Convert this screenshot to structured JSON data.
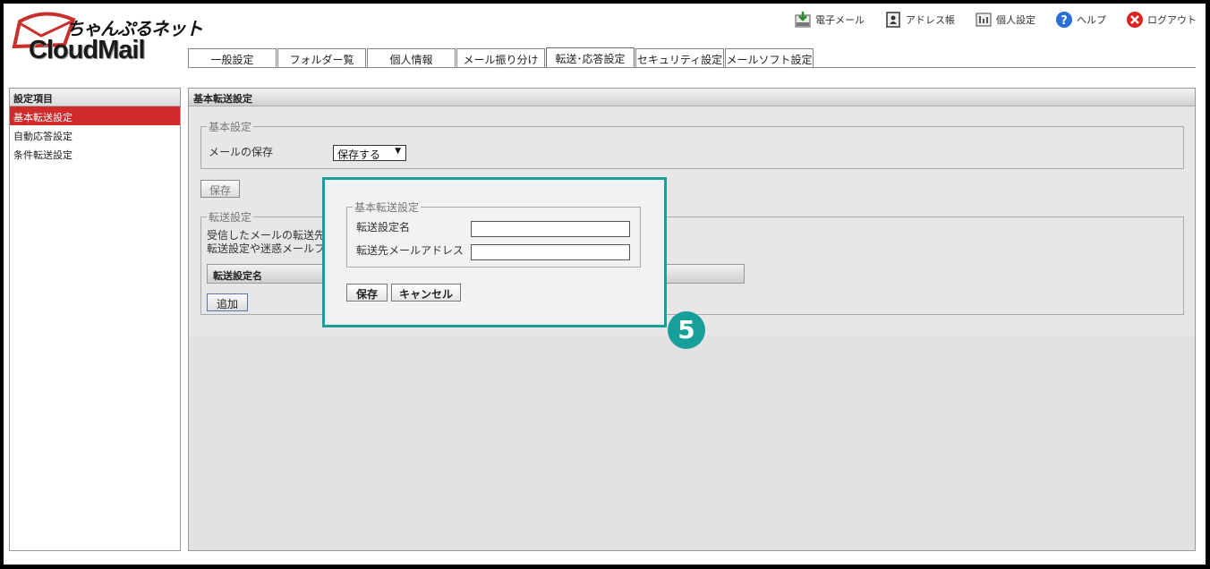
{
  "brand": {
    "logo_jp": "ちゃんぷるネット",
    "logo_en": "CloudMail"
  },
  "topnav": [
    {
      "label": "電子メール",
      "icon": "mail-download-icon"
    },
    {
      "label": "アドレス帳",
      "icon": "address-book-icon"
    },
    {
      "label": "個人設定",
      "icon": "personal-settings-icon"
    },
    {
      "label": "ヘルプ",
      "icon": "help-icon"
    },
    {
      "label": "ログアウト",
      "icon": "logout-icon"
    }
  ],
  "tabs": [
    {
      "label": "一般設定",
      "active": false
    },
    {
      "label": "フォルダー覧",
      "active": false
    },
    {
      "label": "個人情報",
      "active": false
    },
    {
      "label": "メール振り分け",
      "active": false
    },
    {
      "label": "転送･応答設定",
      "active": true
    },
    {
      "label": "セキュリティ設定",
      "active": false
    },
    {
      "label": "メールソフト設定",
      "active": false
    }
  ],
  "sidebar": {
    "header": "設定項目",
    "items": [
      {
        "label": "基本転送設定",
        "active": true
      },
      {
        "label": "自動応答設定",
        "active": false
      },
      {
        "label": "条件転送設定",
        "active": false
      }
    ]
  },
  "main": {
    "header": "基本転送設定",
    "basic": {
      "legend": "基本設定",
      "save_mail_label": "メールの保存",
      "save_mail_value": "保存する",
      "save_button": "保存"
    },
    "forward": {
      "legend": "転送設定",
      "desc_line1": "受信したメールの転送先",
      "desc_line2": "転送設定や迷惑メールフ",
      "table_header": "転送設定名",
      "add_button": "追加"
    }
  },
  "dialog": {
    "legend": "基本転送設定",
    "name_label": "転送設定名",
    "name_value": "",
    "address_label": "転送先メールアドレス",
    "address_value": "",
    "save_button": "保存",
    "cancel_button": "キャンセル"
  },
  "step_badge": "5",
  "colors": {
    "accent": "#d02b2b",
    "highlight": "#17a09a"
  }
}
